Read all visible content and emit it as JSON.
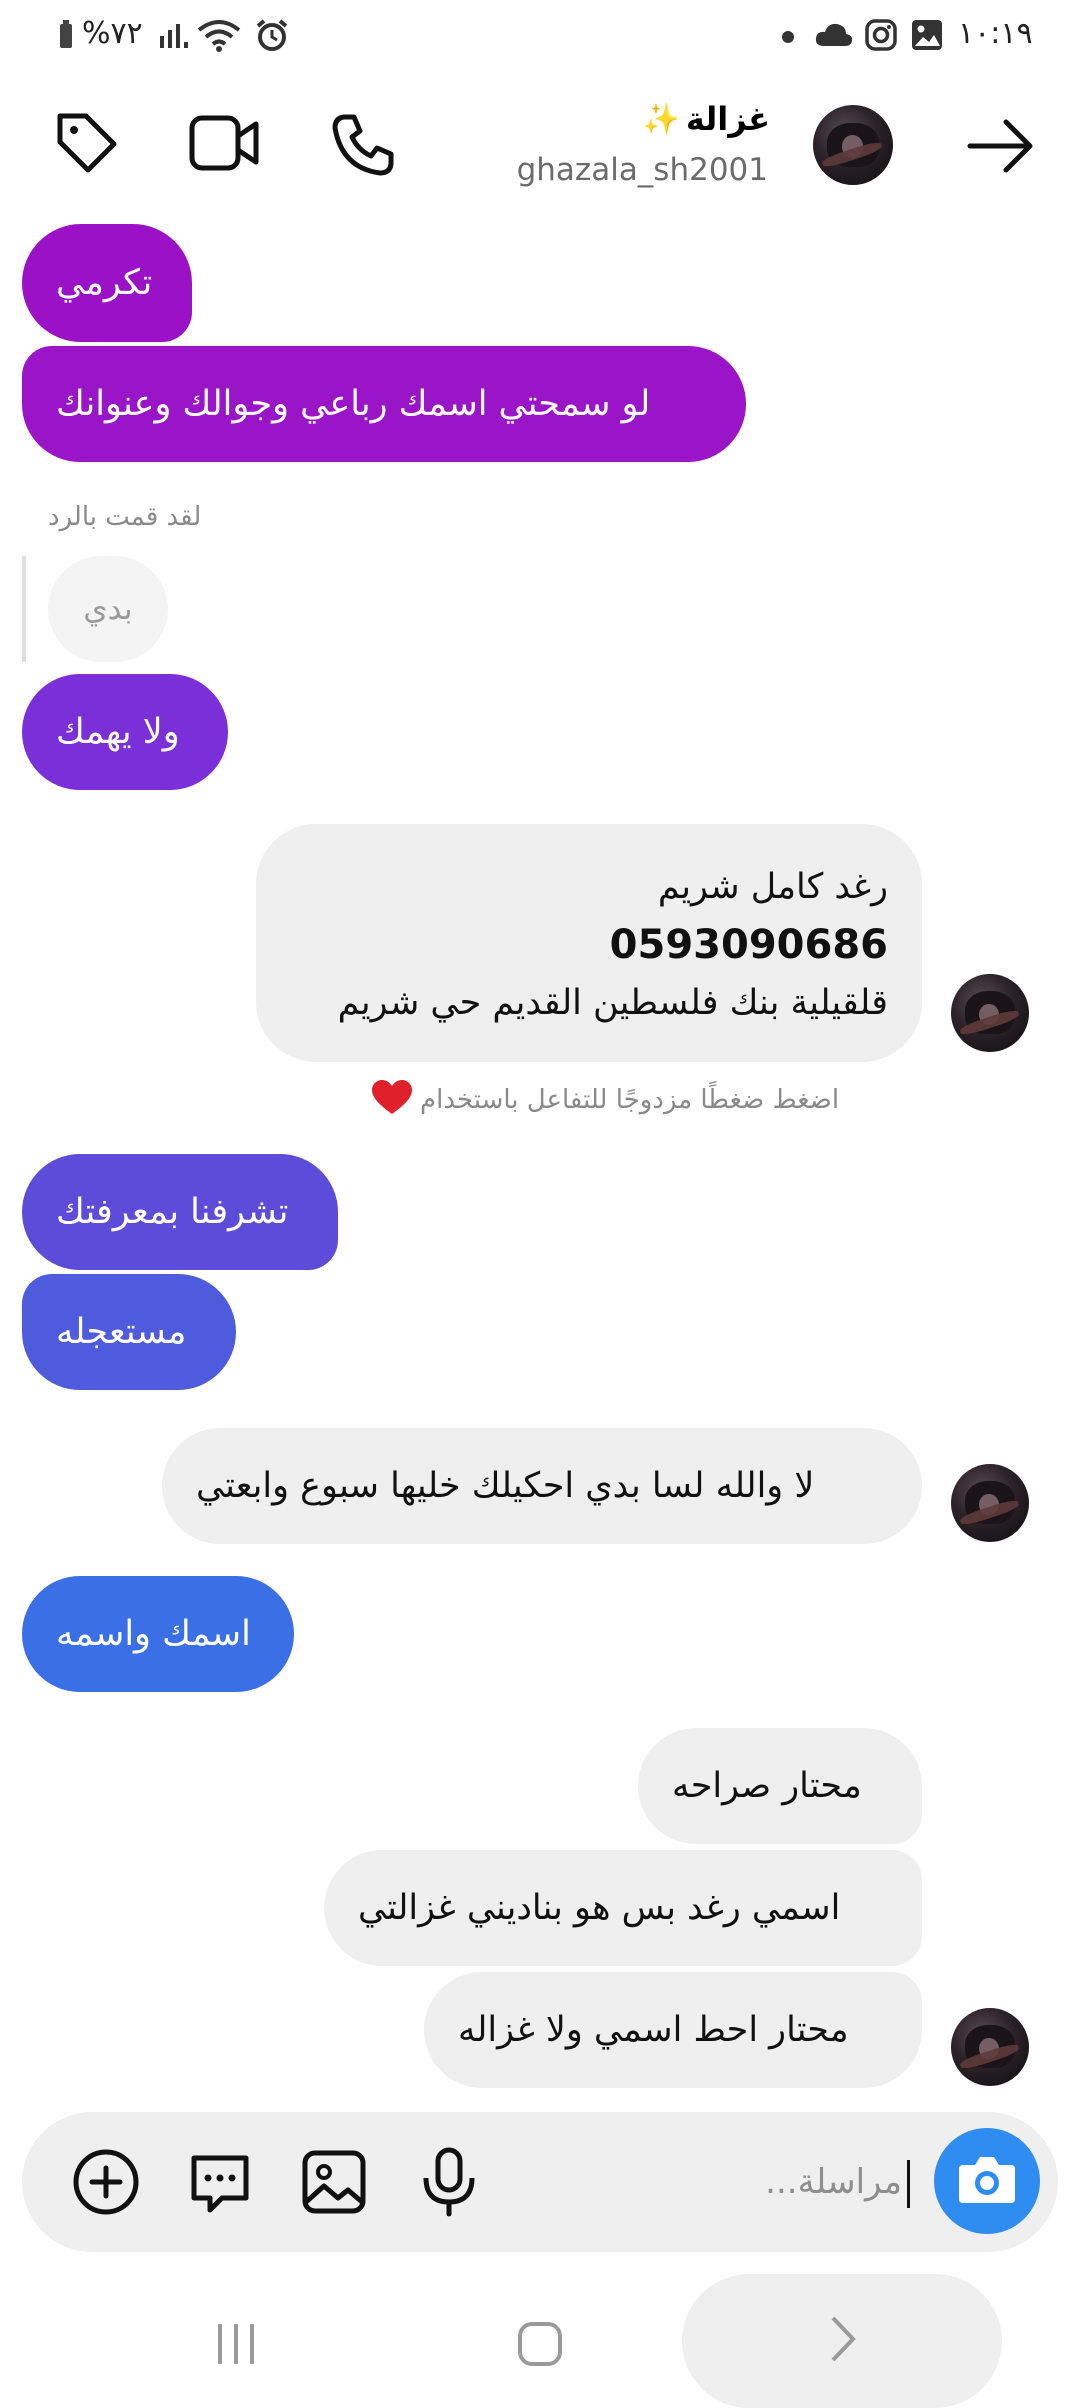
{
  "status_bar": {
    "battery": "%٧٢",
    "time": "١٠:١٩"
  },
  "header": {
    "display_name": "غزالة",
    "name_emoji": "✨",
    "username": "ghazala_sh2001",
    "icons": [
      "tag-icon",
      "video-call-icon",
      "phone-icon",
      "back-arrow-icon"
    ]
  },
  "messages": {
    "m1": "تكرمي",
    "m2": "لو سمحتي اسمك رباعي وجوالك وعنوانك",
    "reply_label": "لقد قمت بالرد",
    "quoted": "بدي",
    "m3": "ولا يهمك",
    "m4_line1": "رغد كامل شريم",
    "m4_line2": "0593090686",
    "m4_line3": "قلقيلية بنك فلسطين القديم حي شريم",
    "hint": "اضغط ضغطًا مزدوجًا للتفاعل باستخدام",
    "m5": "تشرفنا بمعرفتك",
    "m6": "مستعجله",
    "m7": "لا والله لسا بدي احكيلك خليها سبوع وابعتي",
    "m8": "اسمك واسمه",
    "m9": "محتار صراحه",
    "m10": "اسمي رغد بس هو بناديني غزالتي",
    "m11": "محتار احط اسمي ولا غزاله"
  },
  "composer": {
    "placeholder": "مراسلة...",
    "icons": [
      "camera-icon",
      "microphone-icon",
      "gallery-icon",
      "sticker-icon",
      "add-icon"
    ]
  },
  "colors": {
    "bubble_purple": "#9b12c6",
    "bubble_violet": "#7a2fd8",
    "bubble_indigo": "#5a4fdc",
    "bubble_blue": "#3a6fe6",
    "camera_blue": "#2f8cf0",
    "incoming": "#efefef"
  }
}
